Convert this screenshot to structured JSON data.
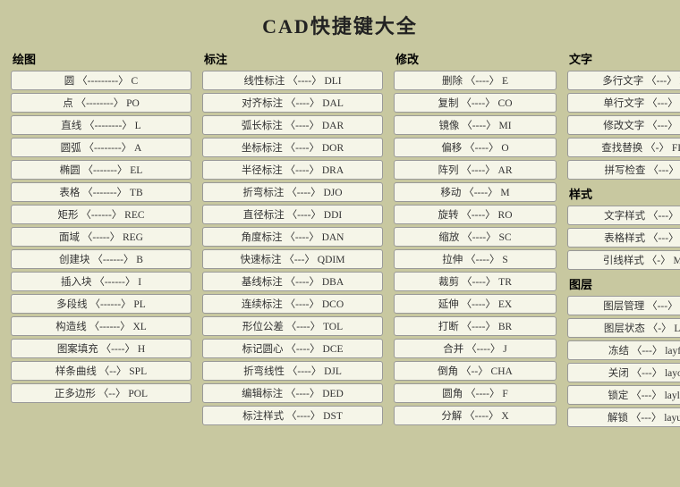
{
  "title": "CAD快捷键大全",
  "sections": [
    {
      "id": "drawing",
      "title": "绘图",
      "items": [
        "圆 〈---------〉 C",
        "点 〈--------〉 PO",
        "直线 〈--------〉 L",
        "圆弧 〈--------〉 A",
        "椭圆 〈-------〉 EL",
        "表格 〈-------〉 TB",
        "矩形 〈------〉 REC",
        "面域 〈-----〉 REG",
        "创建块 〈------〉 B",
        "插入块 〈------〉 I",
        "多段线 〈------〉 PL",
        "构造线 〈------〉 XL",
        "图案填充 〈----〉 H",
        "样条曲线 〈--〉 SPL",
        "正多边形 〈--〉 POL"
      ]
    },
    {
      "id": "annotation",
      "title": "标注",
      "items": [
        "线性标注 〈----〉 DLI",
        "对齐标注 〈----〉 DAL",
        "弧长标注 〈----〉 DAR",
        "坐标标注 〈----〉 DOR",
        "半径标注 〈----〉 DRA",
        "折弯标注 〈----〉 DJO",
        "直径标注 〈----〉 DDI",
        "角度标注 〈----〉 DAN",
        "快速标注 〈---〉 QDIM",
        "基线标注 〈----〉 DBA",
        "连续标注 〈----〉 DCO",
        "形位公差 〈----〉 TOL",
        "标记圆心 〈----〉 DCE",
        "折弯线性 〈----〉 DJL",
        "编辑标注 〈----〉 DED",
        "标注样式 〈----〉 DST"
      ]
    },
    {
      "id": "modify",
      "title": "修改",
      "items": [
        "删除 〈----〉 E",
        "复制 〈----〉 CO",
        "镜像 〈----〉 MI",
        "偏移 〈----〉 O",
        "阵列 〈----〉 AR",
        "移动 〈----〉 M",
        "旋转 〈----〉 RO",
        "缩放 〈----〉 SC",
        "拉伸 〈----〉 S",
        "裁剪 〈----〉 TR",
        "延伸 〈----〉 EX",
        "打断 〈----〉 BR",
        "合并 〈----〉 J",
        "倒角 〈--〉 CHA",
        "圆角 〈----〉 F",
        "分解 〈----〉 X"
      ]
    },
    {
      "id": "text",
      "title": "文字",
      "items_text": [
        "多行文字 〈---〉 MT",
        "单行文字 〈---〉 DT",
        "修改文字 〈---〉 ED",
        "查找替换 〈-〉 FIND",
        "拼写检查 〈---〉 SF"
      ],
      "title_style": "样式",
      "items_style": [
        "文字样式 〈---〉 ST",
        "表格样式 〈---〉 TS",
        "引线样式 〈-〉 MLS"
      ],
      "title_layer": "图层",
      "items_layer": [
        "图层管理 〈---〉 LA",
        "图层状态 〈-〉 LAS",
        "冻结 〈---〉 layfrz",
        "关闭 〈---〉 layoff",
        "锁定 〈---〉 laylck",
        "解锁 〈---〉 layulk"
      ]
    }
  ]
}
